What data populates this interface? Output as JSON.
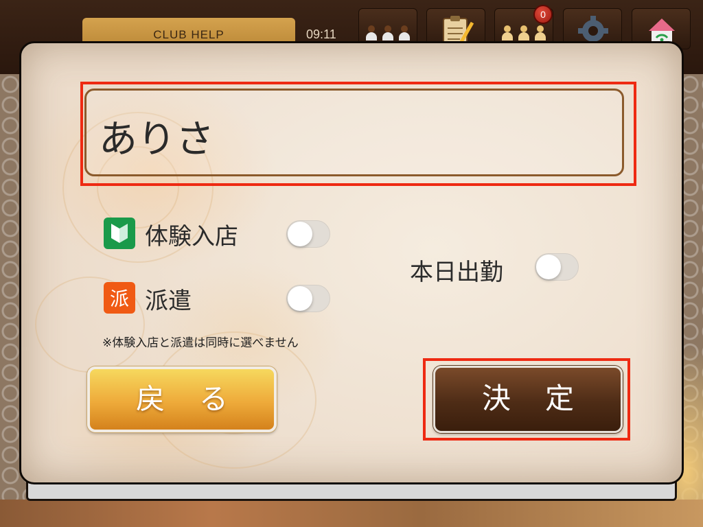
{
  "header": {
    "club_tab_label": "CLUB HELP",
    "clock": "09:11",
    "badge_count": "0"
  },
  "dialog": {
    "name_value": "ありさ",
    "options": {
      "trial": {
        "icon_glyph": "V",
        "label": "体験入店",
        "on": false,
        "icon_color": "#1a9a4a"
      },
      "dispatch": {
        "icon_glyph": "派",
        "label": "派遣",
        "on": false,
        "icon_color": "#f05a14"
      },
      "attendance": {
        "label": "本日出勤",
        "on": false
      }
    },
    "note": "※体験入店と派遣は同時に選べません",
    "back_label": "戻る",
    "ok_label": "決定"
  },
  "colors": {
    "highlight": "#ee2a12",
    "back_button": "#eeaa3a",
    "ok_button": "#4e2c16"
  }
}
